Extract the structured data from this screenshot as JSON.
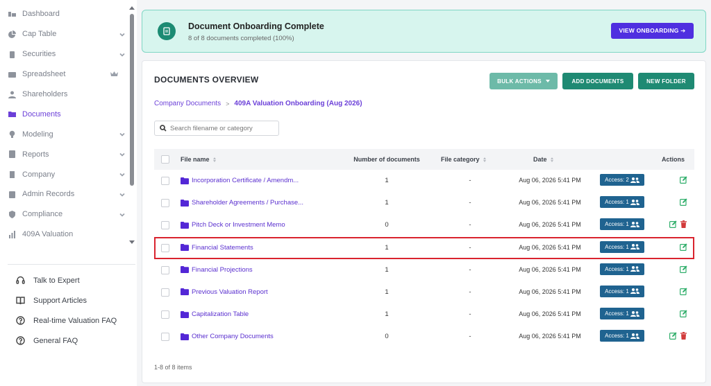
{
  "sidebar": {
    "items": [
      {
        "label": "Dashboard",
        "icon": "dashboard-icon",
        "chevron": false
      },
      {
        "label": "Cap Table",
        "icon": "pie-chart-icon",
        "chevron": true
      },
      {
        "label": "Securities",
        "icon": "clipboard-icon",
        "chevron": true
      },
      {
        "label": "Spreadsheet",
        "icon": "spreadsheet-icon",
        "chevron": false,
        "crown": true
      },
      {
        "label": "Shareholders",
        "icon": "person-icon",
        "chevron": false
      },
      {
        "label": "Documents",
        "icon": "folder-icon",
        "chevron": false,
        "active": true
      },
      {
        "label": "Modeling",
        "icon": "lightbulb-icon",
        "chevron": true
      },
      {
        "label": "Reports",
        "icon": "report-icon",
        "chevron": true
      },
      {
        "label": "Company",
        "icon": "building-icon",
        "chevron": true
      },
      {
        "label": "Admin Records",
        "icon": "records-icon",
        "chevron": true
      },
      {
        "label": "Compliance",
        "icon": "shield-icon",
        "chevron": true
      },
      {
        "label": "409A Valuation",
        "icon": "bar-chart-icon",
        "chevron": false
      }
    ],
    "help": [
      {
        "label": "Talk to Expert",
        "icon": "headset-icon"
      },
      {
        "label": "Support Articles",
        "icon": "book-icon"
      },
      {
        "label": "Real-time Valuation FAQ",
        "icon": "help-circle-icon"
      },
      {
        "label": "General FAQ",
        "icon": "help-circle-icon"
      }
    ]
  },
  "banner": {
    "title": "Document Onboarding Complete",
    "subtitle": "8 of 8 documents completed (100%)",
    "button": "VIEW ONBOARDING ➔"
  },
  "overview": {
    "title": "DOCUMENTS OVERVIEW",
    "bulk_actions": "BULK ACTIONS",
    "add_documents": "ADD DOCUMENTS",
    "new_folder": "NEW FOLDER",
    "breadcrumb": {
      "root": "Company Documents",
      "separator": ">",
      "current": "409A Valuation Onboarding (Aug 2026)"
    },
    "search_placeholder": "Search filename or category",
    "columns": {
      "file_name": "File name",
      "num_docs": "Number of documents",
      "file_category": "File category",
      "date": "Date",
      "actions": "Actions"
    },
    "rows": [
      {
        "name": "Incorporation Certificate / Amendm...",
        "count": "1",
        "category": "-",
        "date": "Aug 06, 2026 5:41 PM",
        "access": "Access: 2",
        "delete": false
      },
      {
        "name": "Shareholder Agreements / Purchase...",
        "count": "1",
        "category": "-",
        "date": "Aug 06, 2026 5:41 PM",
        "access": "Access: 1",
        "delete": false
      },
      {
        "name": "Pitch Deck or Investment Memo",
        "count": "0",
        "category": "-",
        "date": "Aug 06, 2026 5:41 PM",
        "access": "Access: 1",
        "delete": true
      },
      {
        "name": "Financial Statements",
        "count": "1",
        "category": "-",
        "date": "Aug 06, 2026 5:41 PM",
        "access": "Access: 1",
        "delete": false,
        "highlight": true
      },
      {
        "name": "Financial Projections",
        "count": "1",
        "category": "-",
        "date": "Aug 06, 2026 5:41 PM",
        "access": "Access: 1",
        "delete": false
      },
      {
        "name": "Previous Valuation Report",
        "count": "1",
        "category": "-",
        "date": "Aug 06, 2026 5:41 PM",
        "access": "Access: 1",
        "delete": false
      },
      {
        "name": "Capitalization Table",
        "count": "1",
        "category": "-",
        "date": "Aug 06, 2026 5:41 PM",
        "access": "Access: 1",
        "delete": false
      },
      {
        "name": "Other Company Documents",
        "count": "0",
        "category": "-",
        "date": "Aug 06, 2026 5:41 PM",
        "access": "Access: 1",
        "delete": true
      }
    ],
    "footer": "1-8 of 8 items"
  },
  "colors": {
    "accent": "#6b3fd8",
    "primary_green": "#1f8a73",
    "access_blue": "#1f6390",
    "banner_bg": "#d7f5ee",
    "onboarding_btn": "#4f2fe0"
  }
}
